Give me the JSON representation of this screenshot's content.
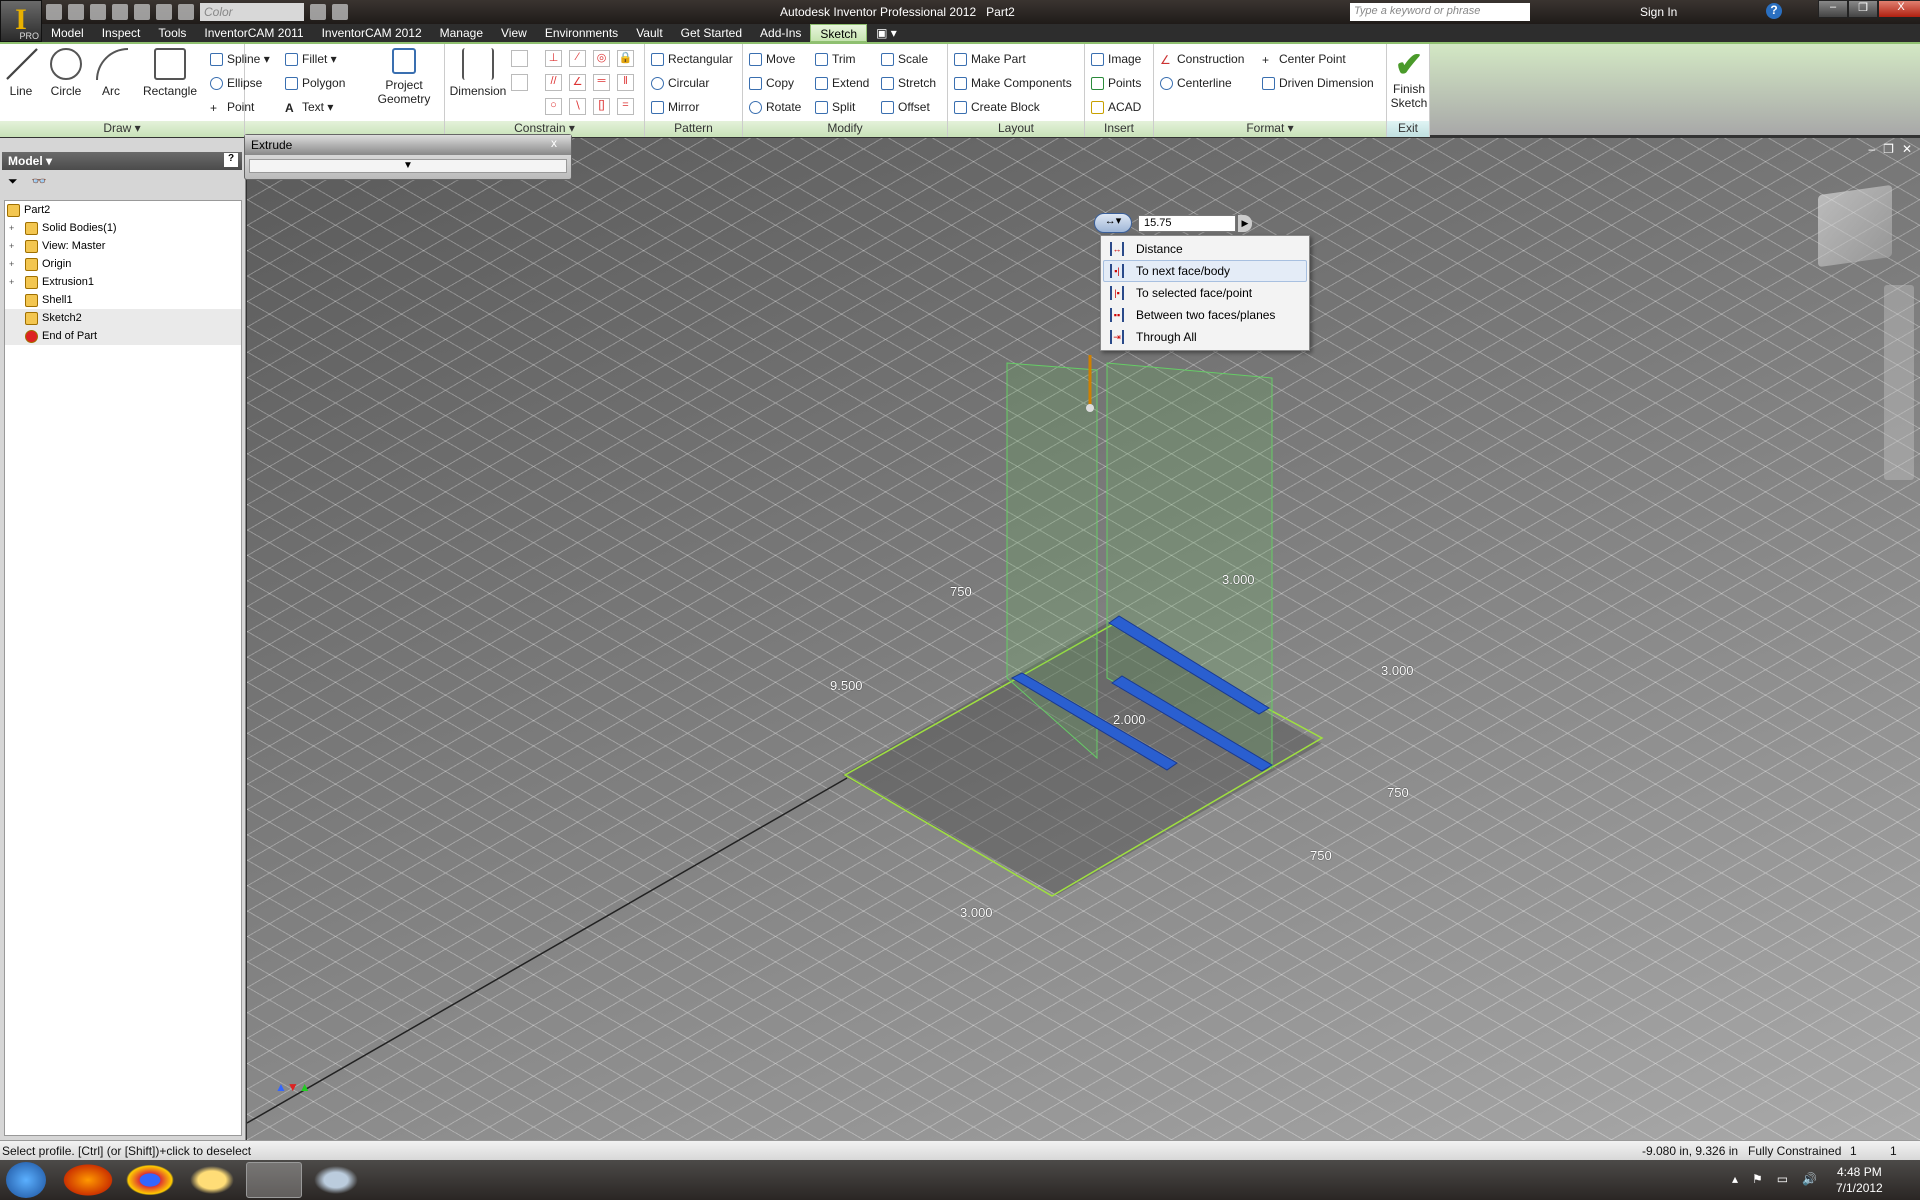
{
  "titlebar": {
    "app_title": "Autodesk Inventor Professional 2012",
    "document": "Part2",
    "color_box": "Color",
    "search_placeholder": "Type a keyword or phrase",
    "sign_in": "Sign In",
    "app_button": "I",
    "app_badge": "PRO",
    "minimize": "–",
    "restore": "❐",
    "close": "X",
    "help": "?"
  },
  "menu": [
    "Model",
    "Inspect",
    "Tools",
    "InventorCAM 2011",
    "InventorCAM 2012",
    "Manage",
    "View",
    "Environments",
    "Vault",
    "Get Started",
    "Add-Ins",
    "Sketch"
  ],
  "menu_active": "Sketch",
  "ribbon": {
    "draw": {
      "label": "Draw ▾",
      "line": "Line",
      "circle": "Circle",
      "arc": "Arc",
      "rectangle": "Rectangle",
      "spline": "Spline ▾",
      "ellipse": "Ellipse",
      "point": "Point",
      "fillet": "Fillet ▾",
      "polygon": "Polygon",
      "text": "Text ▾",
      "project1": "Project",
      "project2": "Geometry"
    },
    "constrain": {
      "label": "Constrain ▾",
      "dimension": "Dimension"
    },
    "pattern": {
      "label": "Pattern",
      "rectangular": "Rectangular",
      "circular": "Circular",
      "mirror": "Mirror"
    },
    "modify": {
      "label": "Modify",
      "move": "Move",
      "copy": "Copy",
      "rotate": "Rotate",
      "trim": "Trim",
      "extend": "Extend",
      "split": "Split",
      "scale": "Scale",
      "stretch": "Stretch",
      "offset": "Offset"
    },
    "layout": {
      "label": "Layout",
      "make_part": "Make Part",
      "make_components": "Make Components",
      "create_block": "Create Block"
    },
    "insert": {
      "label": "Insert",
      "image": "Image",
      "points": "Points",
      "acad": "ACAD"
    },
    "format": {
      "label": "Format ▾",
      "construction": "Construction",
      "centerline": "Centerline",
      "center_point": "Center Point",
      "driven_dimension": "Driven Dimension"
    },
    "exit": {
      "label": "Exit",
      "finish1": "Finish",
      "finish2": "Sketch"
    }
  },
  "browser": {
    "title": "Model ▾",
    "help": "?",
    "items": [
      {
        "label": "Part2",
        "toggle": ""
      },
      {
        "label": "Solid Bodies(1)",
        "toggle": "+"
      },
      {
        "label": "View: Master",
        "toggle": "+"
      },
      {
        "label": "Origin",
        "toggle": "+"
      },
      {
        "label": "Extrusion1",
        "toggle": "+"
      },
      {
        "label": "Shell1",
        "toggle": ""
      },
      {
        "label": "Sketch2",
        "toggle": ""
      },
      {
        "label": "End of Part",
        "toggle": ""
      }
    ]
  },
  "extrude_dialog": {
    "title": "Extrude",
    "close": "x",
    "expand": "▼"
  },
  "minitool": {
    "value": "15.75",
    "mode_icon": "distance-icon"
  },
  "extents_menu": [
    "Distance",
    "To next face/body",
    "To selected face/point",
    "Between two faces/planes",
    "Through All"
  ],
  "extents_highlight": "To next face/body",
  "dimensions": [
    "750",
    "3.000",
    "9.500",
    "2.000",
    "3.000",
    "750",
    "750",
    "3.000"
  ],
  "viewport_controls": {
    "minimize": "–",
    "restore": "❐",
    "close": "✕"
  },
  "status": {
    "prompt": "Select profile. [Ctrl] (or [Shift])+click to deselect",
    "coords": "-9.080 in, 9.326 in",
    "constraint": "Fully Constrained",
    "count1": "1",
    "count2": "1"
  },
  "clock": {
    "time": "4:48 PM",
    "date": "7/1/2012"
  },
  "colors": {
    "accent_green": "#8fc070",
    "profile_blue": "#2a5fd0",
    "sketch_green": "#9fe040"
  }
}
